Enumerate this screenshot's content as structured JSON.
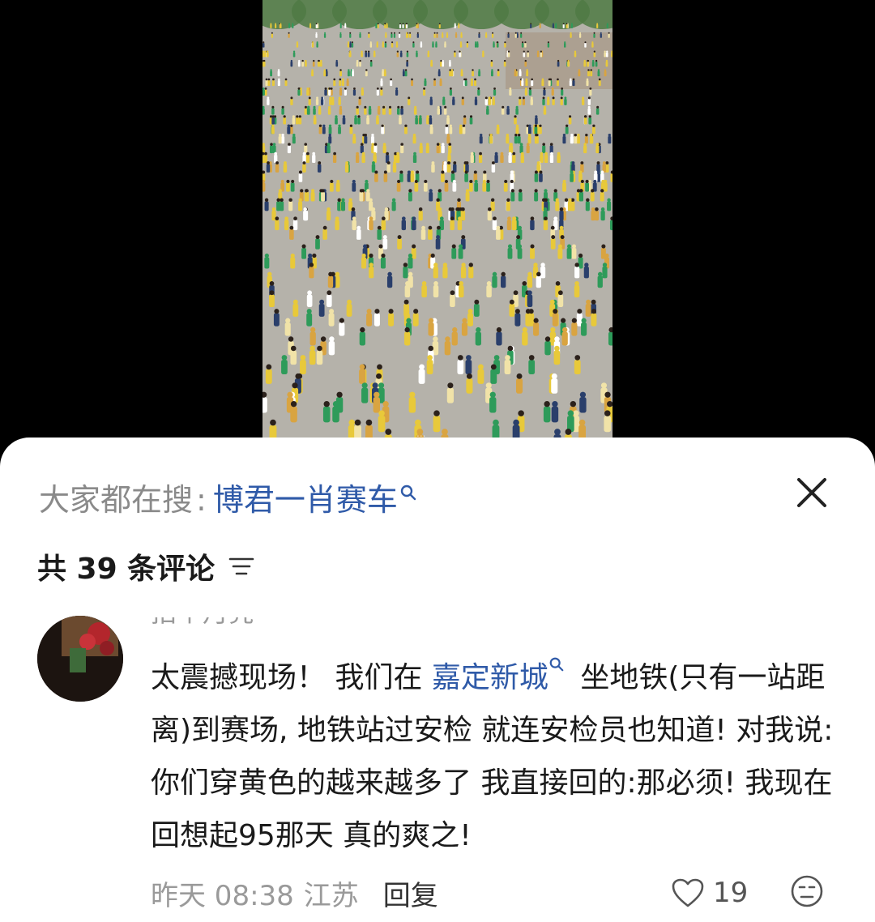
{
  "media": {
    "watermark": "...",
    "colors": {
      "yellow": "#e8c93a",
      "green": "#2e9b5a",
      "pavement": "#b5b2aa",
      "trees": "#4f7a44"
    }
  },
  "search": {
    "prefix": "大家都在搜",
    "separator": ":",
    "term": "博君一肖赛车",
    "icon": "search-icon"
  },
  "close": {
    "icon": "close-icon"
  },
  "comments_header": {
    "count_label": "共 39 条评论",
    "sort_icon": "sort-icon"
  },
  "comment": {
    "author": "拍个月亮",
    "text_before": "太震撼现场！ 我们在 ",
    "mention": "嘉定新城",
    "text_after": " 坐地铁(只有一站距离)到赛场, 地铁站过安检 就连安检员也知道! 对我说:你们穿黄色的越来越多了 我直接回的:那必须! 我现在回想起95那天 真的爽之!",
    "time": "昨天 08:38",
    "location": "江苏",
    "reply_label": "回复",
    "likes": "19"
  },
  "colors": {
    "link": "#2f5aa8",
    "muted": "#9a9a9a",
    "text": "#1a1a1a"
  }
}
